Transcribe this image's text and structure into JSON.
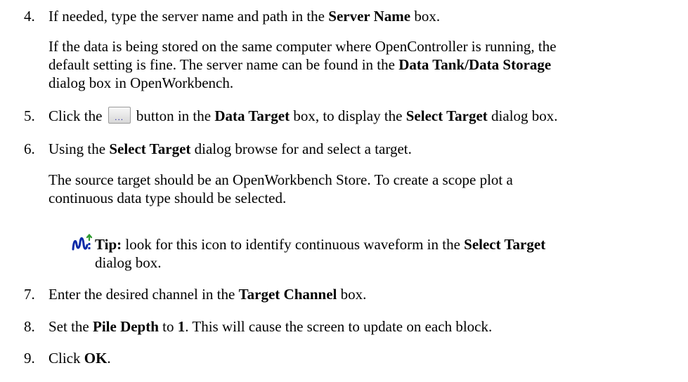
{
  "steps": [
    {
      "number": "4.",
      "parts": [
        "If needed, type the server name and path in the ",
        "Server Name",
        " box."
      ],
      "note_lines": [
        "If the data is being stored on the same computer where OpenController is running, the",
        [
          "default setting is fine. The server name can be found in the ",
          "Data Tank/Data Storage"
        ],
        "dialog box in OpenWorkbench."
      ]
    },
    {
      "number": "5.",
      "parts": [
        "Click the ",
        " button in the ",
        "Data Target",
        " box, to display the ",
        "Select Target",
        " dialog box."
      ],
      "button_glyph": "...",
      "button_icon": "ellipsis-browse-button-icon"
    },
    {
      "number": "6.",
      "parts": [
        "Using the ",
        "Select Target",
        " dialog browse for and select a target."
      ],
      "note_lines": [
        "The source target should be an OpenWorkbench Store. To create a scope plot a",
        "continuous data type should be selected."
      ],
      "tip": {
        "icon": "continuous-waveform-icon",
        "label": "Tip:",
        "text": " look for this icon to identify continuous waveform in the ",
        "bold": "Select Target",
        "line2": "dialog box."
      }
    },
    {
      "number": "7.",
      "parts": [
        "Enter the desired channel in the ",
        "Target Channel",
        " box."
      ]
    },
    {
      "number": "8.",
      "parts": [
        "Set the ",
        "Pile Depth",
        " to ",
        "1",
        ". This will cause the screen to update on each block."
      ]
    },
    {
      "number": "9.",
      "parts": [
        "Click ",
        "OK",
        "."
      ]
    }
  ],
  "colors": {
    "waveform_icon": "#0b2ba8",
    "arrow_icon": "#2e9a2e"
  }
}
